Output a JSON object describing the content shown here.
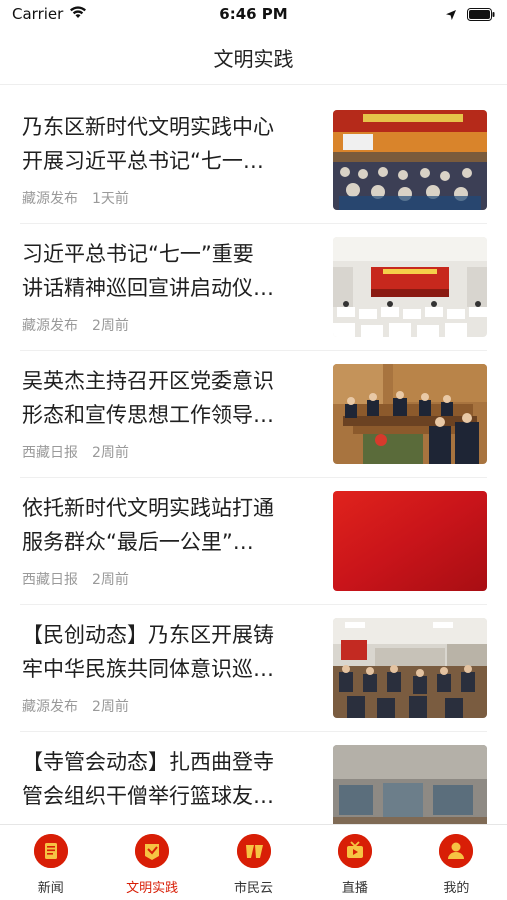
{
  "status_bar": {
    "carrier": "Carrier",
    "time": "6:46 PM"
  },
  "nav": {
    "title": "文明实践"
  },
  "articles": [
    {
      "title_line1": "乃东区新时代文明实践中心",
      "title_line2": "开展习近平总书记“七一…",
      "source": "藏源发布",
      "time": "1天前",
      "image": "conference-hall-photo"
    },
    {
      "title_line1": "习近平总书记“七一”重要",
      "title_line2": "讲话精神巡回宣讲启动仪…",
      "source": "藏源发布",
      "time": "2周前",
      "image": "auditorium-photo"
    },
    {
      "title_line1": "吴英杰主持召开区党委意识",
      "title_line2": "形态和宣传思想工作领导…",
      "source": "西藏日报",
      "time": "2周前",
      "image": "meeting-room-photo"
    },
    {
      "title_line1": "依托新时代文明实践站打通",
      "title_line2": "服务群众“最后一公里”…",
      "source": "西藏日报",
      "time": "2周前",
      "image": "red-banner"
    },
    {
      "title_line1": "【民创动态】乃东区开展铸",
      "title_line2": "牢中华民族共同体意识巡…",
      "source": "藏源发布",
      "time": "2周前",
      "image": "classroom-photo"
    },
    {
      "title_line1": "【寺管会动态】扎西曲登寺",
      "title_line2": "管会组织干僧举行篮球友…",
      "source": "",
      "time": "",
      "image": "gym-photo"
    }
  ],
  "tabs": [
    {
      "label": "新闻",
      "icon": "news-icon"
    },
    {
      "label": "文明实践",
      "icon": "civilization-icon"
    },
    {
      "label": "市民云",
      "icon": "citizen-cloud-icon"
    },
    {
      "label": "直播",
      "icon": "live-tv-icon"
    },
    {
      "label": "我的",
      "icon": "profile-icon"
    }
  ],
  "colors": {
    "accent": "#d81e06",
    "meta_text": "#9a9a9a"
  }
}
